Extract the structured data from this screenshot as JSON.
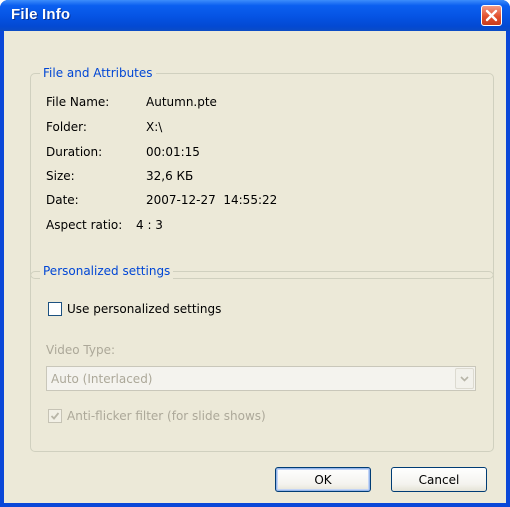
{
  "window": {
    "title": "File Info"
  },
  "file_group": {
    "legend": "File and Attributes",
    "rows": [
      {
        "label": "File Name:",
        "value": "Autumn.pte"
      },
      {
        "label": "Folder:",
        "value": "X:\\"
      },
      {
        "label": "Duration:",
        "value": "00:01:15"
      },
      {
        "label": "Size:",
        "value": "32,6 КБ"
      },
      {
        "label": "Date:",
        "value": "2007-12-27  14:55:22"
      },
      {
        "label": "Aspect ratio:",
        "value": "4 : 3"
      }
    ]
  },
  "personal_group": {
    "legend": "Personalized settings",
    "use_personalized": {
      "label": "Use personalized settings",
      "checked": false
    },
    "video_type": {
      "label": "Video Type:",
      "value": "Auto (Interlaced)"
    },
    "anti_flicker": {
      "label": "Anti-flicker filter (for slide shows)",
      "checked": true
    }
  },
  "buttons": {
    "ok": "OK",
    "cancel": "Cancel"
  },
  "colors": {
    "title_bar": "#0553e3",
    "legend_text": "#0046d5",
    "client_bg": "#ece9d8",
    "close_button": "#e2512e"
  },
  "icons": {
    "close": "close-icon",
    "dropdown": "chevron-down-icon",
    "check": "checkmark-icon"
  }
}
